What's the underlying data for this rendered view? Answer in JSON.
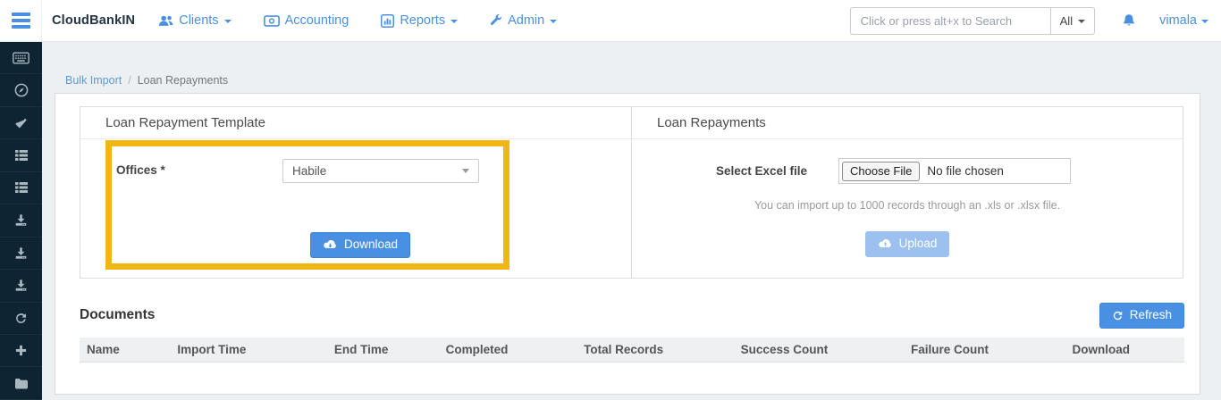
{
  "colors": {
    "accent": "#4a90e2",
    "accent-border": "#3d84d8",
    "disabled-accent": "#9cc1ef",
    "highlight": "#f0b613",
    "sidebar-bg": "#0e2433",
    "sidebar-icon": "#a9b7bf",
    "brand-navy": "#233244",
    "body-bg": "#ecf0f3"
  },
  "navbar": {
    "brand": "CloudBankIN",
    "items": [
      {
        "label": "Clients",
        "icon": "users-icon",
        "has_caret": true
      },
      {
        "label": "Accounting",
        "icon": "money-icon",
        "has_caret": false
      },
      {
        "label": "Reports",
        "icon": "bar-chart-icon",
        "has_caret": true
      },
      {
        "label": "Admin",
        "icon": "wrench-icon",
        "has_caret": true
      }
    ],
    "search": {
      "placeholder": "Click or press alt+x to Search",
      "filter_label": "All"
    },
    "bell_icon": "bell-icon",
    "user": "vimala"
  },
  "sidebar": {
    "icons": [
      "keyboard",
      "compass",
      "check",
      "th-list",
      "th-list",
      "download",
      "download",
      "download",
      "refresh",
      "plus",
      "folder"
    ]
  },
  "breadcrumb": {
    "link": "Bulk Import",
    "separator": "/",
    "current": "Loan Repayments"
  },
  "template_panel": {
    "title": "Loan Repayment Template",
    "offices_label": "Offices *",
    "offices_value": "Habile",
    "download_label": "Download"
  },
  "repayments_panel": {
    "title": "Loan Repayments",
    "file_label": "Select Excel file",
    "choose_file_label": "Choose File",
    "no_file_text": "No file chosen",
    "helper_text": "You can import up to 1000 records through an .xls or .xlsx file.",
    "upload_label": "Upload"
  },
  "documents": {
    "title": "Documents",
    "refresh_label": "Refresh",
    "columns": [
      "Name",
      "Import Time",
      "End Time",
      "Completed",
      "Total Records",
      "Success Count",
      "Failure Count",
      "Download"
    ],
    "rows": []
  }
}
